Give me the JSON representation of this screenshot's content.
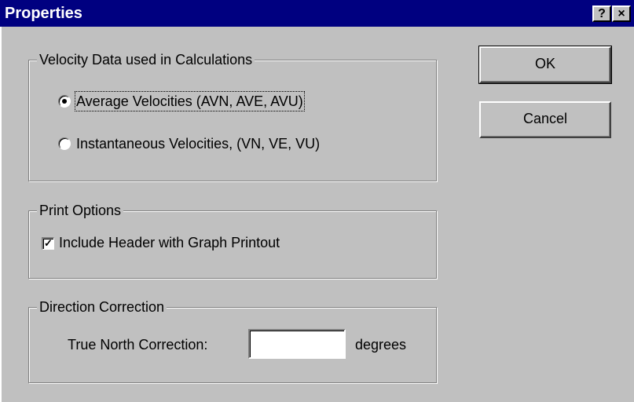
{
  "window": {
    "title": "Properties",
    "help_button": "?",
    "close_button": "×"
  },
  "velocity_group": {
    "legend": "Velocity Data used in Calculations",
    "options": [
      {
        "label": "Average Velocities (AVN, AVE, AVU)",
        "selected": true
      },
      {
        "label": "Instantaneous Velocities, (VN, VE, VU)",
        "selected": false
      }
    ]
  },
  "print_group": {
    "legend": "Print Options",
    "checkbox_label": "Include Header with Graph Printout",
    "checked": true,
    "check_mark": "✓"
  },
  "direction_group": {
    "legend": "Direction Correction",
    "field_label": "True North Correction:",
    "field_value": "",
    "unit": "degrees"
  },
  "buttons": {
    "ok": "OK",
    "cancel": "Cancel"
  }
}
